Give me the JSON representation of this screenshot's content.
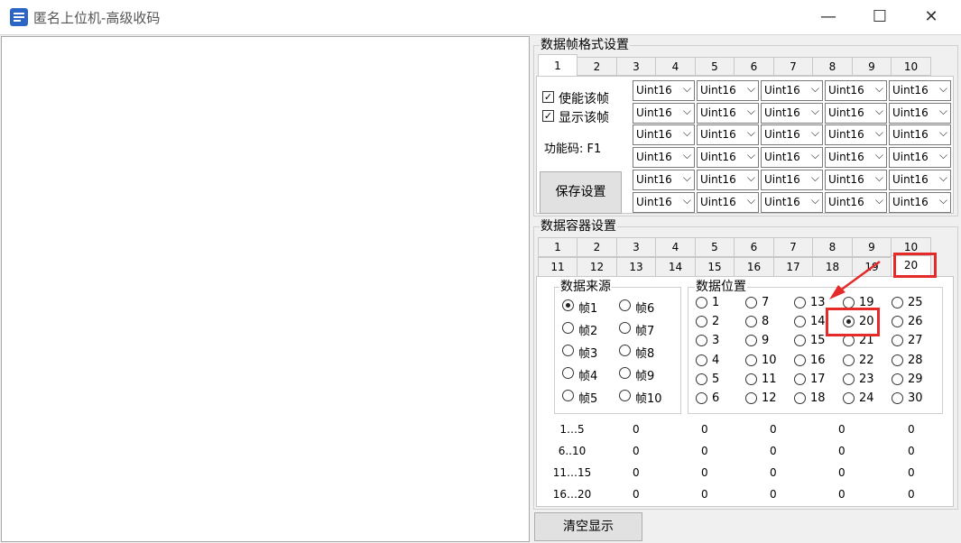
{
  "window": {
    "title": "匿名上位机-高级收码",
    "minimize": "—",
    "maximize": "☐",
    "close": "✕"
  },
  "frame_group": {
    "title": "数据帧格式设置",
    "tabs": [
      "1",
      "2",
      "3",
      "4",
      "5",
      "6",
      "7",
      "8",
      "9",
      "10"
    ],
    "enable_label": "使能该帧",
    "show_label": "显示该帧",
    "func_code_label": "功能码: F1",
    "save_button": "保存设置",
    "combo_value": "Uint16"
  },
  "container_group": {
    "title": "数据容器设置",
    "tabs_row1": [
      "1",
      "2",
      "3",
      "4",
      "5",
      "6",
      "7",
      "8",
      "9",
      "10"
    ],
    "tabs_row2": [
      "11",
      "12",
      "13",
      "14",
      "15",
      "16",
      "17",
      "18",
      "19",
      "20"
    ],
    "source_title": "数据来源",
    "sources": [
      "帧1",
      "帧2",
      "帧3",
      "帧4",
      "帧5",
      "帧6",
      "帧7",
      "帧8",
      "帧9",
      "帧10"
    ],
    "selected_source": "帧1",
    "position_title": "数据位置",
    "positions": [
      "1",
      "2",
      "3",
      "4",
      "5",
      "6",
      "7",
      "8",
      "9",
      "10",
      "11",
      "12",
      "13",
      "14",
      "15",
      "16",
      "17",
      "18",
      "19",
      "20",
      "21",
      "22",
      "23",
      "24",
      "25",
      "26",
      "27",
      "28",
      "29",
      "30"
    ],
    "selected_position": "20"
  },
  "values_table": {
    "rows": [
      {
        "label": "1…5",
        "values": [
          "0",
          "0",
          "0",
          "0",
          "0"
        ]
      },
      {
        "label": "6..10",
        "values": [
          "0",
          "0",
          "0",
          "0",
          "0"
        ]
      },
      {
        "label": "11…15",
        "values": [
          "0",
          "0",
          "0",
          "0",
          "0"
        ]
      },
      {
        "label": "16…20",
        "values": [
          "0",
          "0",
          "0",
          "0",
          "0"
        ]
      }
    ]
  },
  "clear_button": "清空显示",
  "colors": {
    "highlight": "#e52a2a",
    "accent": "#2b66c6"
  }
}
